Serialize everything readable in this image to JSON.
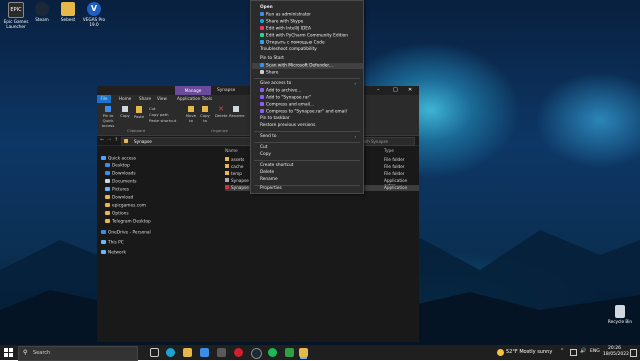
{
  "desktop": {
    "icons": [
      {
        "label": "Epic Games Launcher",
        "color": "#2a2a2a"
      },
      {
        "label": "Steam",
        "color": "#1b2838"
      },
      {
        "label": "Sebest",
        "color": "#e6b84a"
      },
      {
        "label": "VEGAS Pro 19.0",
        "color": "#1e5fbf"
      }
    ],
    "recycle_bin": "Recycle Bin"
  },
  "explorer": {
    "title": "Synapse",
    "manage_tab": "Manage",
    "ribbon_tabs": [
      "File",
      "Home",
      "Share",
      "View",
      "Application Tools"
    ],
    "ribbon": {
      "pin": "Pin to Quick access",
      "copy": "Copy",
      "paste": "Paste",
      "cut": "Cut",
      "copy_path": "Copy path",
      "paste_shortcut": "Paste shortcut",
      "move_to": "Move to",
      "copy_to": "Copy to",
      "delete": "Delete",
      "rename": "Rename",
      "clipboard_group": "Clipboard",
      "organize_group": "Organize"
    },
    "address": "Synapse",
    "search_placeholder": "Search Synapse",
    "nav_items": [
      {
        "label": "Quick access",
        "color": "#4aa3ff"
      },
      {
        "label": "Desktop",
        "color": "#3b8ee8"
      },
      {
        "label": "Downloads",
        "color": "#3b8ee8"
      },
      {
        "label": "Documents",
        "color": "#cfd8e0"
      },
      {
        "label": "Pictures",
        "color": "#6bb6ff"
      },
      {
        "label": "Download",
        "color": "#e6b84a"
      },
      {
        "label": "epicgames.com",
        "color": "#e6b84a"
      },
      {
        "label": "Options",
        "color": "#e6b84a"
      },
      {
        "label": "Telegram Desktop",
        "color": "#e6b84a"
      },
      {
        "label": "OneDrive - Personal",
        "color": "#3b8ee8"
      },
      {
        "label": "This PC",
        "color": "#6bb6ff"
      },
      {
        "label": "Network",
        "color": "#6bb6ff"
      }
    ],
    "col_name": "Name",
    "col_type": "Type",
    "files": [
      {
        "name": "assets",
        "type": "File folder",
        "color": "#e6b84a"
      },
      {
        "name": "cache",
        "type": "File folder",
        "color": "#e6b84a"
      },
      {
        "name": "temp",
        "type": "File folder",
        "color": "#e6b84a"
      },
      {
        "name": "Synapse",
        "type": "Application exten...",
        "color": "#aaaaaa"
      },
      {
        "name": "Synapse",
        "type": "Application",
        "color": "#d13438"
      }
    ]
  },
  "context_menu": {
    "items": [
      {
        "label": "Open",
        "bold": true,
        "icon": ""
      },
      {
        "label": "Run as administrator",
        "icon": "shield-icon",
        "color": "#3b8ee8"
      },
      {
        "label": "Share with Skype",
        "icon": "skype-icon",
        "color": "#00aff0"
      },
      {
        "label": "Edit with IntelliJ IDEA",
        "icon": "intellij-icon",
        "color": "#fe315d"
      },
      {
        "label": "Edit with PyCharm Community Edition",
        "icon": "pycharm-icon",
        "color": "#21d789"
      },
      {
        "label": "Открыть с помощью Code",
        "icon": "vscode-icon",
        "color": "#23a9f2"
      },
      {
        "label": "Troubleshoot compatibility",
        "icon": ""
      },
      {
        "label": "Pin to Start",
        "icon": ""
      },
      {
        "label": "Scan with Microsoft Defender...",
        "icon": "defender-icon",
        "color": "#3b8ee8"
      },
      {
        "label": "Share",
        "icon": "share-icon",
        "color": "#cccccc"
      },
      {
        "label": "Give access to",
        "icon": "",
        "sub": true
      },
      {
        "label": "Add to archive...",
        "icon": "winrar-icon",
        "color": "#8b5cf6"
      },
      {
        "label": "Add to \"Synapse.rar\"",
        "icon": "winrar-icon",
        "color": "#8b5cf6"
      },
      {
        "label": "Compress and email...",
        "icon": "winrar-icon",
        "color": "#8b5cf6"
      },
      {
        "label": "Compress to \"Synapse.rar\" and email",
        "icon": "winrar-icon",
        "color": "#8b5cf6"
      },
      {
        "label": "Pin to taskbar",
        "icon": ""
      },
      {
        "label": "Restore previous versions",
        "icon": ""
      },
      {
        "label": "Send to",
        "icon": "",
        "sub": true
      },
      {
        "label": "Cut",
        "icon": ""
      },
      {
        "label": "Copy",
        "icon": ""
      },
      {
        "label": "Create shortcut",
        "icon": ""
      },
      {
        "label": "Delete",
        "icon": ""
      },
      {
        "label": "Rename",
        "icon": ""
      },
      {
        "label": "Properties",
        "icon": ""
      }
    ]
  },
  "taskbar": {
    "search_placeholder": "Search",
    "weather": "52°F  Mostly sunny",
    "language": "ENG",
    "time": "20:26",
    "date": "18/05/2022"
  }
}
